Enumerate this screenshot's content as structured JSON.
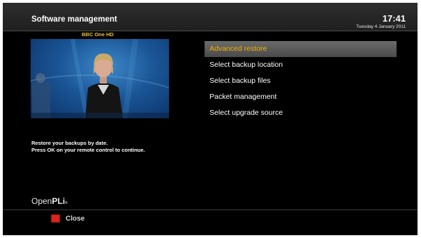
{
  "header": {
    "title": "Software management",
    "time": "17:41",
    "date": "Tuesday  4 January 2011"
  },
  "preview": {
    "channel": "BBC One HD"
  },
  "menu": {
    "items": [
      {
        "label": "Advanced restore",
        "selected": true
      },
      {
        "label": "Select backup location",
        "selected": false
      },
      {
        "label": "Select backup files",
        "selected": false
      },
      {
        "label": "Packet management",
        "selected": false
      },
      {
        "label": "Select upgrade source",
        "selected": false
      }
    ]
  },
  "description": {
    "line1": "Restore your backups by date.",
    "line2": "Press OK on your remote control to continue."
  },
  "logo": {
    "light": "Open",
    "bold": "PLi",
    "suffix": "®"
  },
  "footer": {
    "close_label": "Close",
    "close_icon": "red-button-icon"
  },
  "colors": {
    "background": "#000000",
    "header": "#2a2a2a",
    "selected_text": "#f2b000",
    "selected_bar": "#5a5a5a",
    "channel_label": "#e8c23a",
    "red_key": "#d8231f"
  }
}
